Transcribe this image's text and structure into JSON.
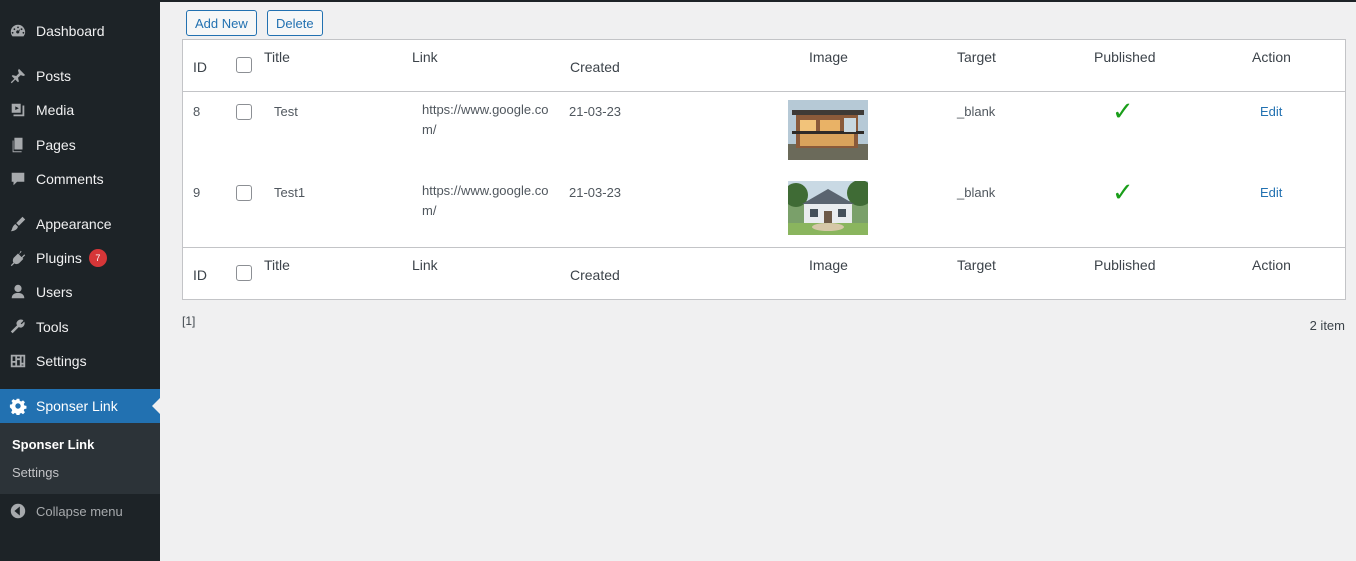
{
  "sidebar": {
    "items": [
      {
        "label": "Dashboard",
        "icon": "dashboard-icon"
      },
      {
        "label": "Posts",
        "icon": "pin-icon"
      },
      {
        "label": "Media",
        "icon": "media-icon"
      },
      {
        "label": "Pages",
        "icon": "pages-icon"
      },
      {
        "label": "Comments",
        "icon": "comment-icon"
      },
      {
        "label": "Appearance",
        "icon": "brush-icon"
      },
      {
        "label": "Plugins",
        "icon": "plug-icon",
        "badge": "7"
      },
      {
        "label": "Users",
        "icon": "user-icon"
      },
      {
        "label": "Tools",
        "icon": "wrench-icon"
      },
      {
        "label": "Settings",
        "icon": "sliders-icon"
      },
      {
        "label": "Sponser Link",
        "icon": "gear-icon"
      }
    ],
    "submenu": [
      {
        "label": "Sponser Link"
      },
      {
        "label": "Settings"
      }
    ],
    "collapse_label": "Collapse menu"
  },
  "toolbar": {
    "add_new_label": "Add New",
    "delete_label": "Delete"
  },
  "table": {
    "headers": {
      "id": "ID",
      "title": "Title",
      "link": "Link",
      "created": "Created",
      "image": "Image",
      "target": "Target",
      "published": "Published",
      "action": "Action"
    },
    "rows": [
      {
        "id": "8",
        "title": "Test",
        "link": "https://www.google.com/",
        "created": "21-03-23",
        "target": "_blank",
        "published": "✓",
        "action": "Edit"
      },
      {
        "id": "9",
        "title": "Test1",
        "link": "https://www.google.com/",
        "created": "21-03-23",
        "target": "_blank",
        "published": "✓",
        "action": "Edit"
      }
    ]
  },
  "pagination": {
    "pages": "[1]",
    "count": "2 item"
  },
  "colors": {
    "sidebar_bg": "#1d2327",
    "accent": "#2271b1",
    "badge": "#d63638",
    "published_check": "#1a9e1a"
  }
}
